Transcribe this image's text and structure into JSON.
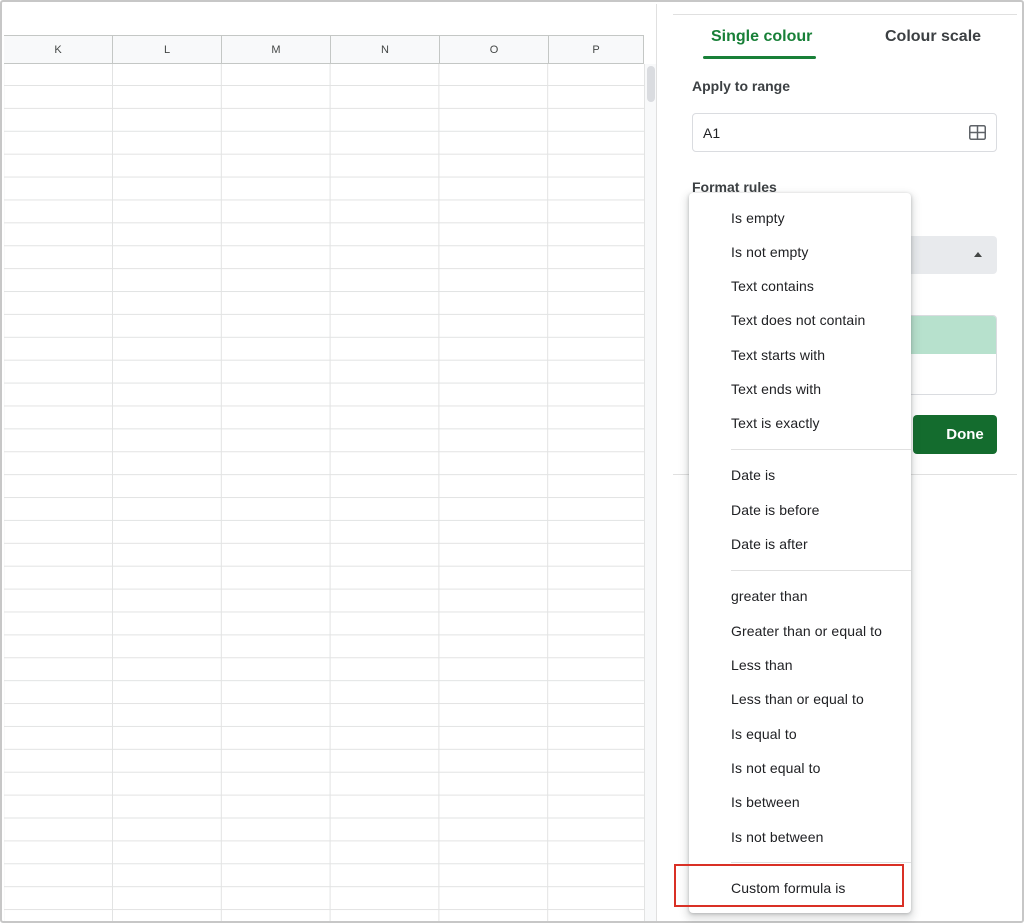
{
  "sheet": {
    "columns": [
      "K",
      "L",
      "M",
      "N",
      "O",
      "P"
    ]
  },
  "panel": {
    "tabs": [
      "Single colour",
      "Colour scale"
    ],
    "apply_to_range_label": "Apply to range",
    "range_value": "A1",
    "format_rules_label": "Format rules",
    "done_label": "Done",
    "colors": {
      "accent": "#188038",
      "done": "#146c2e",
      "preview_fill": "#b7e1cd"
    }
  },
  "dropdown": {
    "groups": [
      [
        "Is empty",
        "Is not empty",
        "Text contains",
        "Text does not contain",
        "Text starts with",
        "Text ends with",
        "Text is exactly"
      ],
      [
        "Date is",
        "Date is before",
        "Date is after"
      ],
      [
        "greater than",
        "Greater than or equal to",
        "Less than",
        "Less than or equal to",
        "Is equal to",
        "Is not equal to",
        "Is between",
        "Is not between"
      ],
      [
        "Custom formula is"
      ]
    ],
    "highlighted_item": "Custom formula is",
    "highlight_color": "#d93025"
  }
}
